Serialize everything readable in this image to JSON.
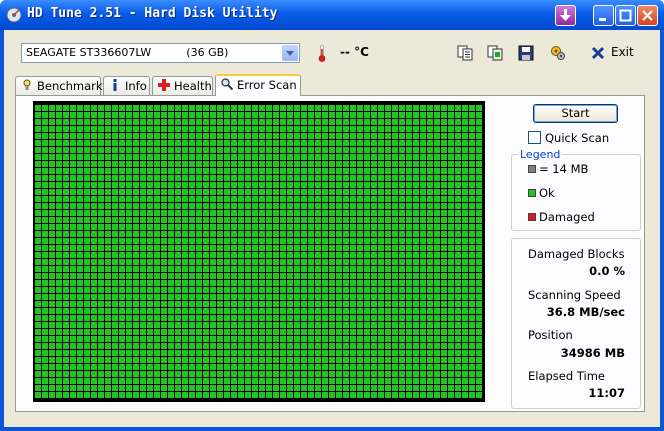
{
  "window": {
    "title": "HD Tune 2.51 - Hard Disk Utility",
    "title_bar_color": "#0a5ce8"
  },
  "toolbar": {
    "drive": {
      "name": "SEAGATE ST336607LW",
      "capacity": "(36 GB)"
    },
    "temperature": "-- °C",
    "icons": [
      "copy-info-icon",
      "copy-screenshot-icon",
      "save-icon",
      "options-icon"
    ],
    "exit_label": "Exit"
  },
  "tabs": [
    {
      "label": "Benchmark",
      "icon": "benchmark-icon",
      "active": false
    },
    {
      "label": "Info",
      "icon": "info-icon",
      "active": false
    },
    {
      "label": "Health",
      "icon": "health-icon",
      "active": false
    },
    {
      "label": "Error Scan",
      "icon": "magnifier-icon",
      "active": true
    }
  ],
  "scan": {
    "start_label": "Start",
    "quick_scan_label": "Quick Scan",
    "quick_scan_checked": false,
    "grid_cell_color": "#22c322",
    "legend": {
      "title": "Legend",
      "items": [
        {
          "label": "= 14 MB",
          "color": "#808080"
        },
        {
          "label": "Ok",
          "color": "#22c322"
        },
        {
          "label": "Damaged",
          "color": "#d42020"
        }
      ]
    },
    "stats": [
      {
        "label": "Damaged Blocks",
        "value": "0.0 %"
      },
      {
        "label": "Scanning Speed",
        "value": "36.8 MB/sec"
      },
      {
        "label": "Position",
        "value": "34986 MB"
      },
      {
        "label": "Elapsed Time",
        "value": "11:07"
      }
    ]
  }
}
